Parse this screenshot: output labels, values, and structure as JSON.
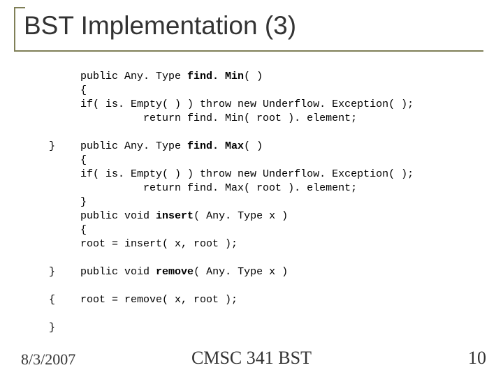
{
  "title": "BST Implementation (3)",
  "code": {
    "l1a": "public Any. Type ",
    "l1b": "find. Min",
    "l1c": "( )",
    "l2": "{",
    "l3": "if( is. Empty( ) ) throw new Underflow. Exception( );",
    "l4": "          return find. Min( root ). element;",
    "g5": "}",
    "l6a": "public Any. Type ",
    "l6b": "find. Max",
    "l6c": "( )",
    "l7": "{",
    "l8": "if( is. Empty( ) ) throw new Underflow. Exception( );",
    "l9": "          return find. Max( root ). element;",
    "l10": "}",
    "l11a": "public void ",
    "l11b": "insert",
    "l11c": "( Any. Type x )",
    "l12": "{",
    "l13": "root = insert( x, root );",
    "g14": "}",
    "l15a": "public void ",
    "l15b": "remove",
    "l15c": "( Any. Type x )",
    "g16": "{",
    "l17": "root = remove( x, root );",
    "g18": "}"
  },
  "footer": {
    "date": "8/3/2007",
    "center": "CMSC 341 BST",
    "page": "10"
  }
}
